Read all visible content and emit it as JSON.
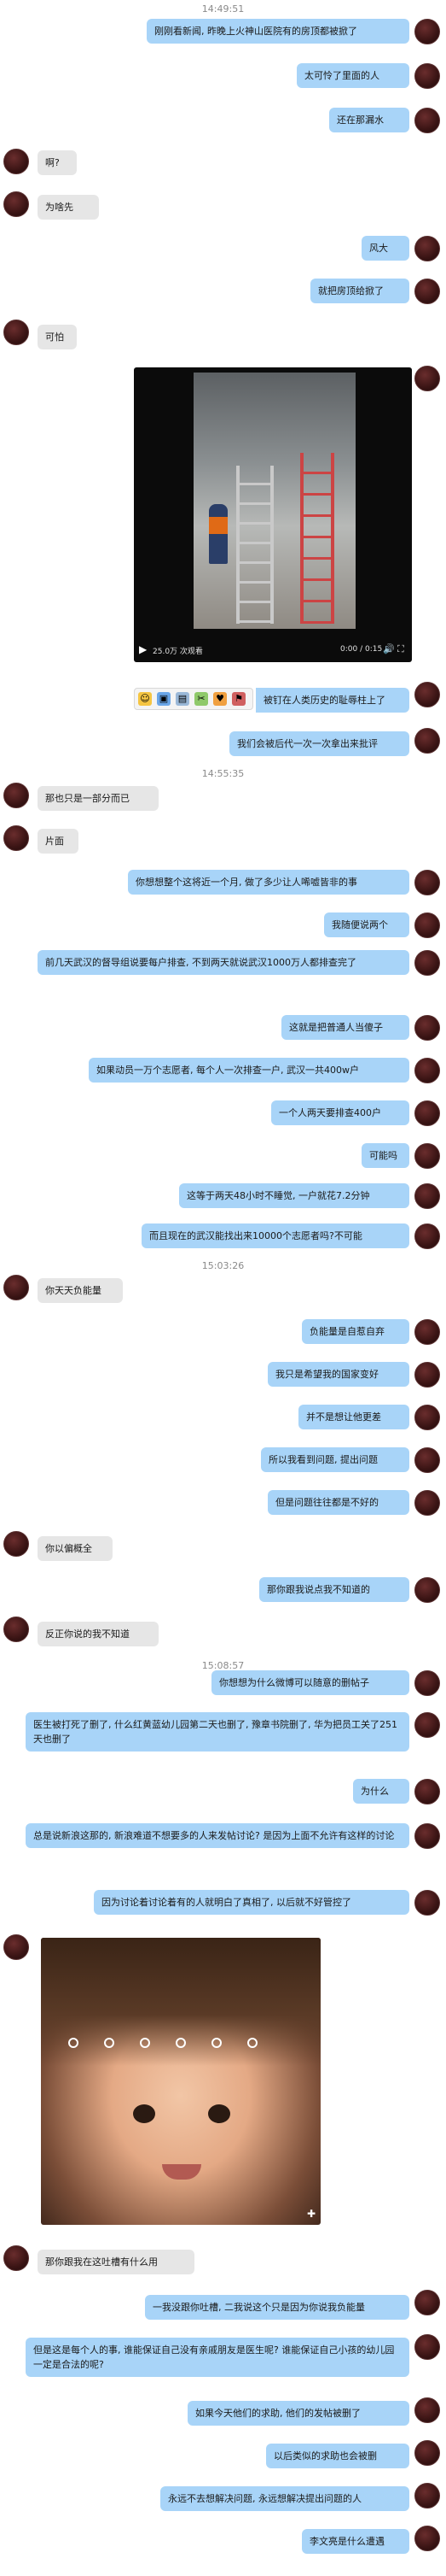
{
  "timestamps": [
    "14:49:51",
    "14:55:35",
    "15:03:26",
    "15:08:57"
  ],
  "messages": {
    "m1": "刚刚看新闻, 昨晚上火神山医院有的房顶都被掀了",
    "m2": "太可怜了里面的人",
    "m3": "还在那漏水",
    "m4": "啊?",
    "m5": "为啥先",
    "m6": "风大",
    "m7": "就把房顶给掀了",
    "m8": "可怕",
    "m9": "被钉在人类历史的耻辱柱上了",
    "m10": "我们会被后代一次一次拿出来批评",
    "m11": "那也只是一部分而已",
    "m12": "片面",
    "m13": "你想想整个这将近一个月, 做了多少让人唏嘘皆非的事",
    "m14": "我随便说两个",
    "m15": "前几天武汉的督导组说要每户排查, 不到两天就说武汉1000万人都排查完了",
    "m16": "这就是把普通人当傻子",
    "m17": "如果动员一万个志愿者, 每个人一次排查一户, 武汉一共400w户",
    "m18": "一个人两天要排查400户",
    "m19": "可能吗",
    "m20": "这等于两天48小时不睡觉, 一户就花7.2分钟",
    "m21": "而且现在的武汉能找出来10000个志愿者吗?不可能",
    "m22": "你天天负能量",
    "m23": "负能量是自惹自弃",
    "m24": "我只是希望我的国家变好",
    "m25": "并不是想让他更差",
    "m26": "所以我看到问题, 提出问题",
    "m27": "但是问题往往都是不好的",
    "m28": "你以偏概全",
    "m29": "那你跟我说点我不知道的",
    "m30": "反正你说的我不知道",
    "m31": "你想想为什么微博可以随意的删帖子",
    "m32": "医生被打死了删了, 什么红黄蓝幼儿园第二天也删了, 豫章书院删了, 华为把员工关了251天也删了",
    "m33": "为什么",
    "m34": "总是说新浪这那的, 新浪难道不想要多的人来发帖讨论? 是因为上面不允许有这样的讨论",
    "m35": "因为讨论着讨论着有的人就明白了真相了, 以后就不好管控了",
    "m36": "那你跟我在这吐槽有什么用",
    "m37": "一我没跟你吐槽, 二我说这个只是因为你说我负能量",
    "m38": "但是这是每个人的事, 谁能保证自己没有亲戚朋友是医生呢? 谁能保证自己小孩的幼儿园一定是合法的呢?",
    "m39": "如果今天他们的求助, 他们的发帖被删了",
    "m40": "以后类似的求助也会被删",
    "m41": "永远不去想解决问题, 永远想解决提出问题的人",
    "m42": "李文亮是什么遭遇"
  },
  "video": {
    "play_icon": "play-icon",
    "views": "25.0万 次观看",
    "time": "0:00 / 0:15",
    "volume_icon": "volume-icon",
    "fullscreen_icon": "fullscreen-icon"
  },
  "toolbar_icons": [
    "emoji-icon",
    "image-icon",
    "file-icon",
    "screenshot-icon",
    "gift-icon",
    "flag-icon"
  ],
  "photo": {
    "dots": [
      "dot-1",
      "dot-2",
      "dot-3",
      "dot-4",
      "dot-5",
      "dot-6"
    ],
    "zoom_icon": "zoom-icon"
  },
  "colors": {
    "my_bubble": "#a8d4f8",
    "their_bubble": "#e6e6e6",
    "background": "#ffffff"
  }
}
